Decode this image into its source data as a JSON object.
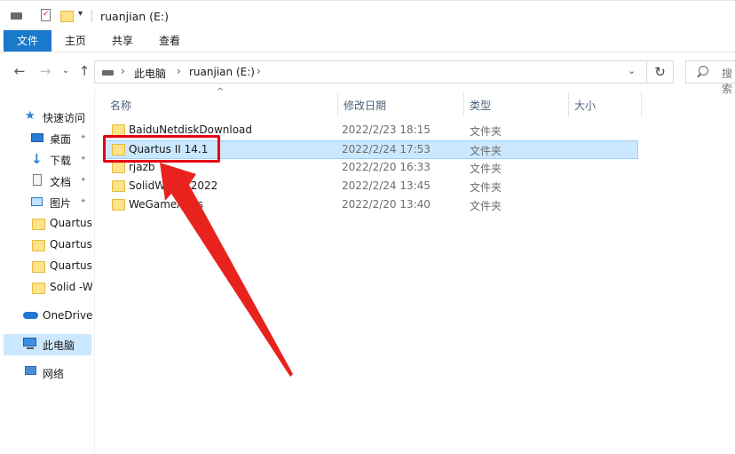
{
  "window": {
    "title": "ruanjian (E:)"
  },
  "ribbon": {
    "tabs": [
      "文件",
      "主页",
      "共享",
      "查看"
    ]
  },
  "address": {
    "segments": [
      "此电脑",
      "ruanjian (E:)"
    ]
  },
  "search": {
    "placeholder": "搜索"
  },
  "sidebar": {
    "quick_access": "快速访问",
    "items": [
      {
        "label": "桌面",
        "icon": "desktop-icon",
        "pinned": true
      },
      {
        "label": "下载",
        "icon": "download-icon",
        "pinned": true
      },
      {
        "label": "文档",
        "icon": "document-icon",
        "pinned": true
      },
      {
        "label": "图片",
        "icon": "pictures-icon",
        "pinned": true
      },
      {
        "label": "Quartus",
        "icon": "folder-icon",
        "pinned": false
      },
      {
        "label": "Quartus",
        "icon": "folder-icon",
        "pinned": false
      },
      {
        "label": "Quartus",
        "icon": "folder-icon",
        "pinned": false
      },
      {
        "label": "Solid -W",
        "icon": "folder-icon",
        "pinned": false
      }
    ],
    "onedrive": "OneDrive",
    "this_pc": "此电脑",
    "network": "网络"
  },
  "columns": {
    "name": "名称",
    "modified": "修改日期",
    "type": "类型",
    "size": "大小"
  },
  "files": [
    {
      "name": "BaiduNetdiskDownload",
      "modified": "2022/2/23 18:15",
      "type": "文件夹",
      "selected": false
    },
    {
      "name": "Quartus II 14.1",
      "modified": "2022/2/24 17:53",
      "type": "文件夹",
      "selected": true
    },
    {
      "name": "rjazb",
      "modified": "2022/2/20 16:33",
      "type": "文件夹",
      "selected": false
    },
    {
      "name": "SolidWorks 2022",
      "modified": "2022/2/24 13:45",
      "type": "文件夹",
      "selected": false
    },
    {
      "name": "WeGameApps",
      "modified": "2022/2/20 13:40",
      "type": "文件夹",
      "selected": false
    }
  ],
  "colors": {
    "accent": "#1979ca",
    "selection": "#cce8ff",
    "annotation": "#e60012"
  }
}
